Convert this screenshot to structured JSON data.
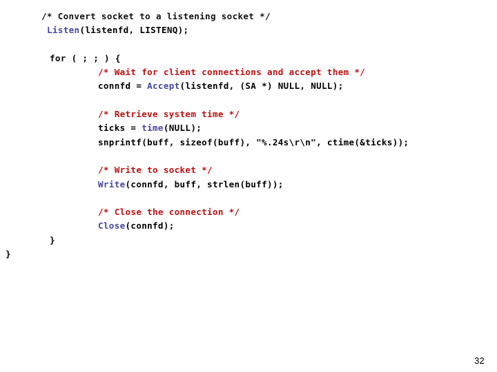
{
  "slide": {
    "page_number": "32",
    "background_color": "#ffffff",
    "colors": {
      "plain": "#000000",
      "comment": "#BB1111",
      "comment_first": "#111111",
      "function": "#47479B"
    }
  },
  "code": {
    "language": "C",
    "lines": [
      {
        "indent": 1,
        "tokens": [
          {
            "kind": "comment-dark",
            "text": "/* Convert socket to a listening socket */"
          }
        ]
      },
      {
        "indent": 2,
        "tokens": [
          {
            "kind": "fn",
            "text": "Listen"
          },
          {
            "kind": "plain",
            "text": "(listenfd, LISTENQ);"
          }
        ]
      },
      {
        "indent": 0,
        "blank": true,
        "tokens": []
      },
      {
        "indent": 3,
        "tokens": [
          {
            "kind": "plain",
            "text": "for ( ; ; ) {"
          }
        ]
      },
      {
        "indent": 4,
        "tokens": [
          {
            "kind": "comment",
            "text": "/* Wait for client connections and accept them */"
          }
        ]
      },
      {
        "indent": 4,
        "tokens": [
          {
            "kind": "plain",
            "text": "connfd = "
          },
          {
            "kind": "fn",
            "text": "Accept"
          },
          {
            "kind": "plain",
            "text": "(listenfd, (SA *) NULL, NULL);"
          }
        ]
      },
      {
        "indent": 0,
        "blank": true,
        "tokens": []
      },
      {
        "indent": 4,
        "tokens": [
          {
            "kind": "comment",
            "text": "/* Retrieve system time */"
          }
        ]
      },
      {
        "indent": 4,
        "tokens": [
          {
            "kind": "plain",
            "text": "ticks = "
          },
          {
            "kind": "fn",
            "text": "time"
          },
          {
            "kind": "plain",
            "text": "(NULL);"
          }
        ]
      },
      {
        "indent": 4,
        "tokens": [
          {
            "kind": "plain",
            "text": "snprintf(buff, sizeof(buff), \"%.24s\\r\\n\", ctime(&ticks));"
          }
        ]
      },
      {
        "indent": 0,
        "blank": true,
        "tokens": []
      },
      {
        "indent": 4,
        "tokens": [
          {
            "kind": "comment",
            "text": "/* Write to socket */"
          }
        ]
      },
      {
        "indent": 4,
        "tokens": [
          {
            "kind": "fn",
            "text": "Write"
          },
          {
            "kind": "plain",
            "text": "(connfd, buff, strlen(buff));"
          }
        ]
      },
      {
        "indent": 0,
        "blank": true,
        "tokens": []
      },
      {
        "indent": 4,
        "tokens": [
          {
            "kind": "comment",
            "text": "/* Close the connection */"
          }
        ]
      },
      {
        "indent": 4,
        "tokens": [
          {
            "kind": "fn",
            "text": "Close"
          },
          {
            "kind": "plain",
            "text": "(connfd);"
          }
        ]
      },
      {
        "indent": 3,
        "tokens": [
          {
            "kind": "plain",
            "text": "}"
          }
        ]
      },
      {
        "indent": 0,
        "tokens": [
          {
            "kind": "plain",
            "text": "}"
          }
        ]
      }
    ]
  }
}
